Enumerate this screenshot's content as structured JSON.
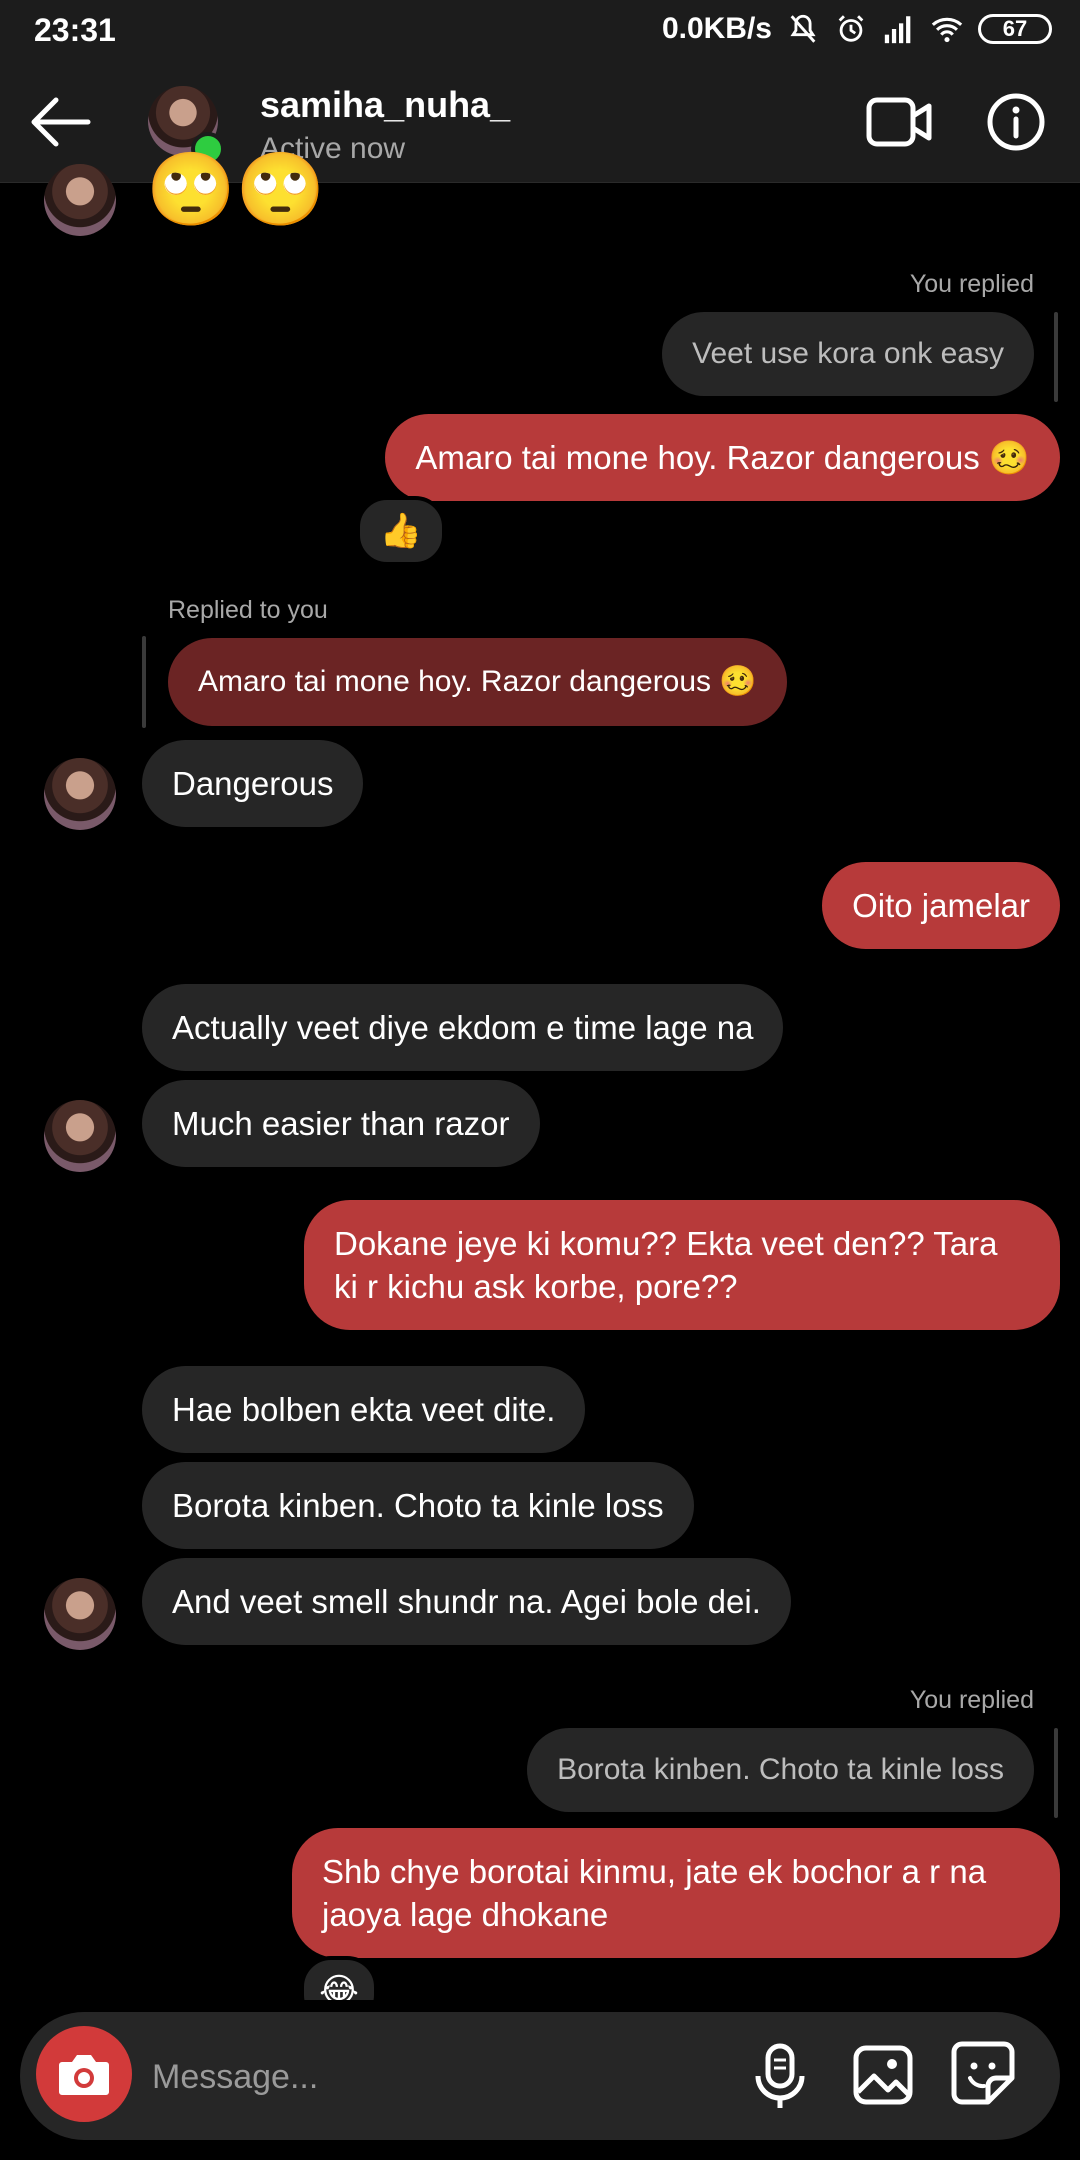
{
  "status_bar": {
    "time": "23:31",
    "network_speed": "0.0KB/s",
    "battery": "67",
    "icons": [
      "mute-bell-icon",
      "alarm-icon",
      "signal-icon",
      "wifi-icon",
      "battery-icon"
    ]
  },
  "header": {
    "username": "samiha_nuha_",
    "status": "Active now",
    "icons": [
      "back-arrow-icon",
      "video-call-icon",
      "info-icon"
    ]
  },
  "messages": {
    "top_emoji": "🙄🙄",
    "you_replied_1": "You replied",
    "quote_1": "Veet use kora onk easy",
    "out_1": "Amaro tai mone hoy. Razor dangerous 🥴",
    "reaction_1": "👍",
    "replied_to_you": "Replied to you",
    "quote_2": "Amaro tai mone hoy. Razor dangerous 🥴",
    "in_1": "Dangerous",
    "out_2": "Oito jamelar",
    "in_2": "Actually veet diye ekdom e time lage na",
    "in_3": "Much easier than razor",
    "out_3_line1": "Dokane jeye ki komu?? Ekta veet den?? Tara",
    "out_3_line2": "ki r kichu ask korbe, pore??",
    "in_4": "Hae bolben ekta veet dite.",
    "in_5": "Borota kinben. Choto ta kinle loss",
    "in_6": "And veet smell shundr na. Agei bole dei.",
    "you_replied_2": "You replied",
    "quote_3": "Borota kinben. Choto ta kinle loss",
    "out_4_line1": "Shb chye borotai kinmu, jate ek bochor a r na",
    "out_4_line2": "jaoya lage dhokane",
    "reaction_2": "😂"
  },
  "composer": {
    "placeholder": "Message...",
    "icons": [
      "camera-icon",
      "microphone-icon",
      "gallery-icon",
      "sticker-icon"
    ]
  },
  "colors": {
    "outgoing_bubble": "#b73a3a",
    "incoming_bubble": "#262626",
    "background": "#000000",
    "online_dot": "#2ecc40"
  }
}
